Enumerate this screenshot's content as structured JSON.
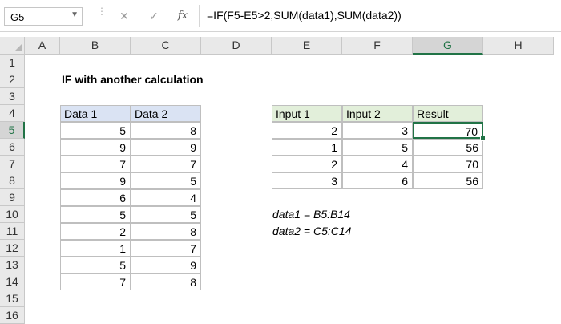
{
  "formula_bar": {
    "name_box": "G5",
    "cancel_glyph": "✕",
    "enter_glyph": "✓",
    "fx_glyph": "fx",
    "formula": "=IF(F5-E5>2,SUM(data1),SUM(data2))"
  },
  "columns": [
    "A",
    "B",
    "C",
    "D",
    "E",
    "F",
    "G",
    "H"
  ],
  "rows": [
    "1",
    "2",
    "3",
    "4",
    "5",
    "6",
    "7",
    "8",
    "9",
    "10",
    "11",
    "12",
    "13",
    "14",
    "15",
    "16"
  ],
  "selected_cell": "G5",
  "sheet": {
    "title": "IF with another calculation",
    "data_table": {
      "headers": [
        "Data 1",
        "Data 2"
      ],
      "rows": [
        [
          "5",
          "8"
        ],
        [
          "9",
          "9"
        ],
        [
          "7",
          "7"
        ],
        [
          "9",
          "5"
        ],
        [
          "6",
          "4"
        ],
        [
          "5",
          "5"
        ],
        [
          "2",
          "8"
        ],
        [
          "1",
          "7"
        ],
        [
          "5",
          "9"
        ],
        [
          "7",
          "8"
        ]
      ]
    },
    "result_table": {
      "headers": [
        "Input 1",
        "Input 2",
        "Result"
      ],
      "rows": [
        [
          "2",
          "3",
          "70"
        ],
        [
          "1",
          "5",
          "56"
        ],
        [
          "2",
          "4",
          "70"
        ],
        [
          "3",
          "6",
          "56"
        ]
      ]
    },
    "notes": [
      "data1 = B5:B14",
      "data2 = C5:C14"
    ]
  },
  "colors": {
    "accent": "#217346",
    "header_blue": "#dae3f3",
    "header_green": "#e2efda"
  }
}
